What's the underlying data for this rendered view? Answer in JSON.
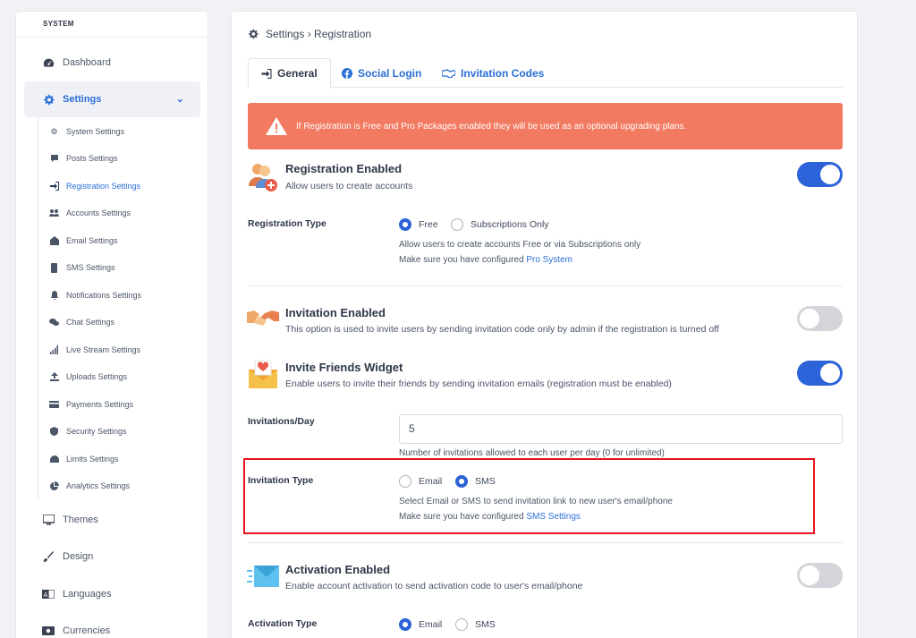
{
  "sidebar": {
    "section_label": "SYSTEM",
    "nav": [
      {
        "label": "Dashboard",
        "icon": "dashboard-icon"
      },
      {
        "label": "Settings",
        "icon": "gear-icon",
        "active": true
      },
      {
        "label": "Themes",
        "icon": "monitor-icon"
      },
      {
        "label": "Design",
        "icon": "brush-icon"
      },
      {
        "label": "Languages",
        "icon": "language-icon"
      },
      {
        "label": "Currencies",
        "icon": "money-icon"
      }
    ],
    "settings_sub": [
      {
        "label": "System Settings",
        "icon": "cogs-icon"
      },
      {
        "label": "Posts Settings",
        "icon": "comment-icon"
      },
      {
        "label": "Registration Settings",
        "icon": "sign-in-icon",
        "active": true
      },
      {
        "label": "Accounts Settings",
        "icon": "users-icon"
      },
      {
        "label": "Email Settings",
        "icon": "envelope-open-icon"
      },
      {
        "label": "SMS Settings",
        "icon": "mobile-icon"
      },
      {
        "label": "Notifications Settings",
        "icon": "bell-icon"
      },
      {
        "label": "Chat Settings",
        "icon": "comments-icon"
      },
      {
        "label": "Live Stream Settings",
        "icon": "signal-icon"
      },
      {
        "label": "Uploads Settings",
        "icon": "upload-icon"
      },
      {
        "label": "Payments Settings",
        "icon": "credit-card-icon"
      },
      {
        "label": "Security Settings",
        "icon": "shield-icon"
      },
      {
        "label": "Limits Settings",
        "icon": "gauge-icon"
      },
      {
        "label": "Analytics Settings",
        "icon": "pie-chart-icon"
      }
    ]
  },
  "breadcrumb": "Settings › Registration",
  "tabs": [
    {
      "label": "General",
      "icon": "sign-in-icon",
      "active": true
    },
    {
      "label": "Social Login",
      "icon": "facebook-icon"
    },
    {
      "label": "Invitation Codes",
      "icon": "handshake-icon"
    }
  ],
  "alert": "If Registration is Free and Pro Packages enabled they will be used as an optional upgrading plans.",
  "registration": {
    "title": "Registration Enabled",
    "desc": "Allow users to create accounts",
    "enabled": true,
    "type_label": "Registration Type",
    "options": [
      "Free",
      "Subscriptions Only"
    ],
    "selected": "Free",
    "help1": "Allow users to create accounts Free or via Subscriptions only",
    "help2_prefix": "Make sure you have configured ",
    "help2_link": "Pro System"
  },
  "invitation": {
    "title": "Invitation Enabled",
    "desc": "This option is used to invite users by sending invitation code only by admin if the registration is turned off",
    "enabled": false
  },
  "invite_friends": {
    "title": "Invite Friends Widget",
    "desc": "Enable users to invite their friends by sending invitation emails (registration must be enabled)",
    "enabled": true,
    "per_day_label": "Invitations/Day",
    "per_day_value": "5",
    "per_day_help": "Number of invitations allowed to each user per day (0 for unlimited)",
    "type_label": "Invitation Type",
    "type_options": [
      "Email",
      "SMS"
    ],
    "type_selected": "SMS",
    "type_help1": "Select Email or SMS to send invitation link to new user's email/phone",
    "type_help2_prefix": "Make sure you have configured ",
    "type_help2_link": "SMS Settings"
  },
  "activation": {
    "title": "Activation Enabled",
    "desc": "Enable account activation to send activation code to user's email/phone",
    "enabled": false,
    "type_label": "Activation Type",
    "options": [
      "Email",
      "SMS"
    ],
    "selected": "Email"
  },
  "colors": {
    "accent": "#2d63d8",
    "alert": "#f27a60",
    "highlight": "#e8141a"
  }
}
